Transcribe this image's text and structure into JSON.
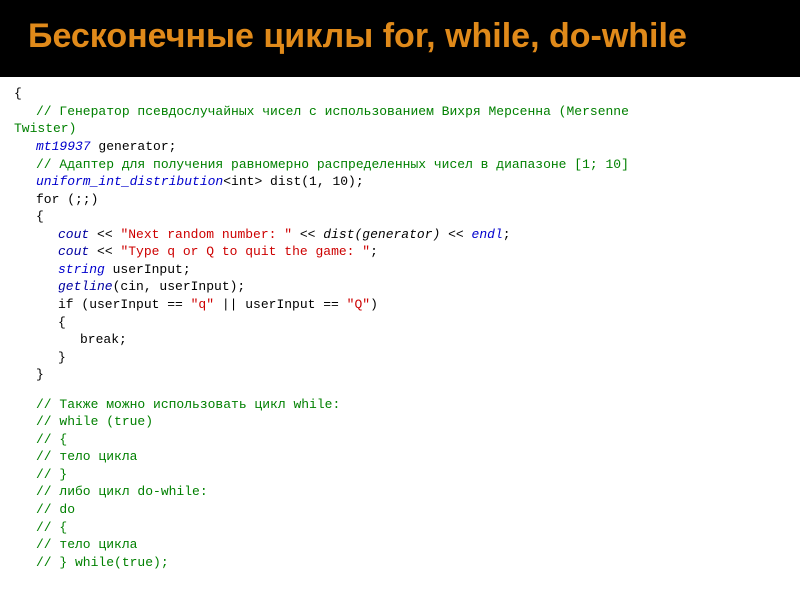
{
  "header": {
    "title": "Бесконечные циклы for, while, do-while"
  },
  "code": {
    "brace_open": "{",
    "c1a": "// Генератор псевдослучайных чисел с использованием Вихря Мерсенна (Mersenne",
    "c1b": "Twister)",
    "type_mt": "mt19937",
    "gen_decl": " generator;",
    "c2": "// Адаптер для получения равномерно распределенных чисел в диапазоне [1; 10]",
    "type_uid": "uniform_int_distribution",
    "uid_tpl": "<int> dist(1, 10);",
    "for_line": "for (;;)",
    "brace2_open": "{",
    "cout1_a": "cout",
    "cout1_op1": " << ",
    "cout1_str": "\"Next random number: \"",
    "cout1_op2": " << ",
    "cout1_call": "dist(generator)",
    "cout1_op3": " << ",
    "cout1_endl": "endl",
    "cout1_end": ";",
    "cout2_a": "cout",
    "cout2_op1": " << ",
    "cout2_str": "\"Type q or Q to quit the game: \"",
    "cout2_end": ";",
    "string_kw": "string",
    "userinput_decl": " userInput;",
    "getline_call": "getline",
    "getline_args": "(cin, userInput);",
    "if_a": "if (userInput == ",
    "if_q1": "\"q\"",
    "if_b": " || userInput == ",
    "if_q2": "\"Q\"",
    "if_c": ")",
    "brace3_open": "{",
    "break_stmt": "break;",
    "brace3_close": "}",
    "brace2_close": "}",
    "c3": "// Также можно использовать цикл while:",
    "c4": "//  while (true)",
    "c5": "//  {",
    "c6": "//    тело цикла",
    "c7": "//  }",
    "c8": "// либо цикл do-while:",
    "c9": "//  do",
    "c10": "//  {",
    "c11": "//    тело цикла",
    "c12": "//  } while(true);"
  }
}
